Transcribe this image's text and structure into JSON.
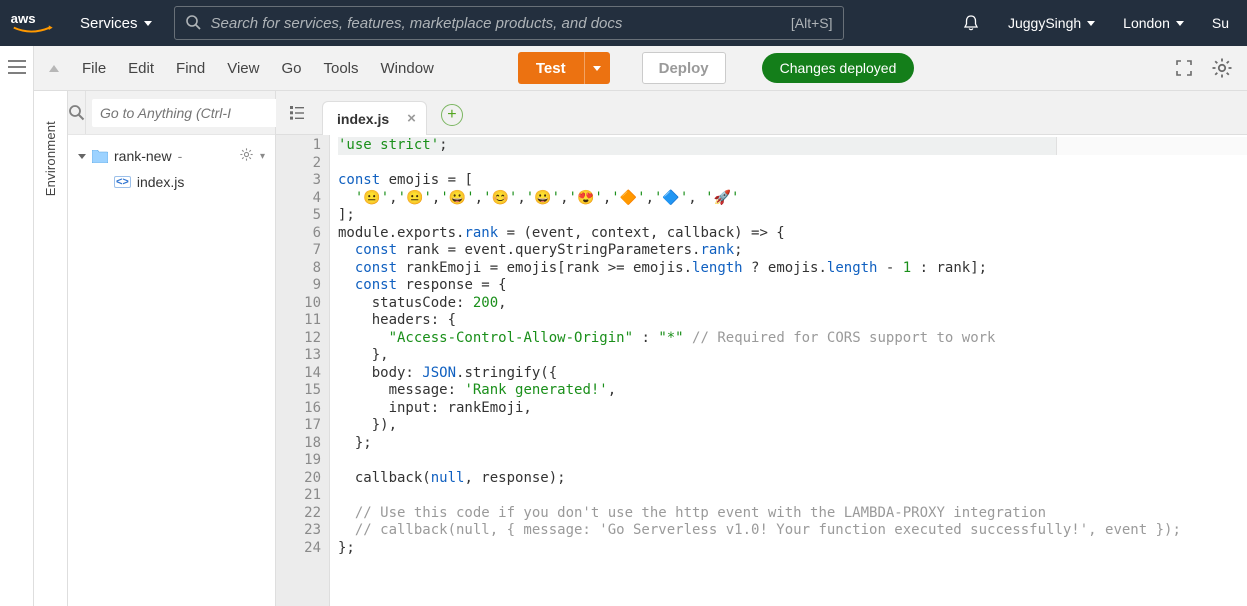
{
  "nav": {
    "services_label": "Services",
    "search_placeholder": "Search for services, features, marketplace products, and docs",
    "search_shortcut": "[Alt+S]",
    "user": "JuggySingh",
    "region": "London",
    "support_truncated": "Su"
  },
  "rail": {
    "label": "Environment"
  },
  "menubar": {
    "items": [
      "File",
      "Edit",
      "Find",
      "View",
      "Go",
      "Tools",
      "Window"
    ],
    "test": "Test",
    "deploy": "Deploy",
    "status": "Changes deployed"
  },
  "sidebar": {
    "goto_placeholder": "Go to Anything (Ctrl-I",
    "folder": "rank-new",
    "folder_suffix": " - ",
    "file": "index.js"
  },
  "tabs": {
    "active": "index.js"
  },
  "code": {
    "lines": [
      [
        [
          "str",
          "'use strict'"
        ],
        [
          "id",
          ";"
        ]
      ],
      [],
      [
        [
          "kw",
          "const"
        ],
        [
          "id",
          " emojis = ["
        ]
      ],
      [
        [
          "id",
          "  "
        ],
        [
          "str",
          "'😐'"
        ],
        [
          "id",
          ","
        ],
        [
          "str",
          "'😐'"
        ],
        [
          "id",
          ","
        ],
        [
          "str",
          "'😀'"
        ],
        [
          "id",
          ","
        ],
        [
          "str",
          "'😊'"
        ],
        [
          "id",
          ","
        ],
        [
          "str",
          "'😀'"
        ],
        [
          "id",
          ","
        ],
        [
          "str",
          "'😍'"
        ],
        [
          "id",
          ","
        ],
        [
          "str",
          "'🔶'"
        ],
        [
          "id",
          ","
        ],
        [
          "str",
          "'🔷'"
        ],
        [
          "id",
          ", "
        ],
        [
          "str",
          "'🚀'"
        ]
      ],
      [
        [
          "id",
          "];"
        ]
      ],
      [
        [
          "id",
          "module.exports."
        ],
        [
          "prop",
          "rank"
        ],
        [
          "id",
          " = (event, context, callback) => {"
        ]
      ],
      [
        [
          "id",
          "  "
        ],
        [
          "kw",
          "const"
        ],
        [
          "id",
          " rank = event.queryStringParameters."
        ],
        [
          "prop",
          "rank"
        ],
        [
          "id",
          ";"
        ]
      ],
      [
        [
          "id",
          "  "
        ],
        [
          "kw",
          "const"
        ],
        [
          "id",
          " rankEmoji = emojis[rank >= emojis."
        ],
        [
          "prop",
          "length"
        ],
        [
          "id",
          " ? emojis."
        ],
        [
          "prop",
          "length"
        ],
        [
          "id",
          " - "
        ],
        [
          "num",
          "1"
        ],
        [
          "id",
          " : rank];"
        ]
      ],
      [
        [
          "id",
          "  "
        ],
        [
          "kw",
          "const"
        ],
        [
          "id",
          " response = {"
        ]
      ],
      [
        [
          "id",
          "    statusCode: "
        ],
        [
          "num",
          "200"
        ],
        [
          "id",
          ","
        ]
      ],
      [
        [
          "id",
          "    headers: {"
        ]
      ],
      [
        [
          "id",
          "      "
        ],
        [
          "str",
          "\"Access-Control-Allow-Origin\""
        ],
        [
          "id",
          " : "
        ],
        [
          "str",
          "\"*\""
        ],
        [
          "id",
          " "
        ],
        [
          "com",
          "// Required for CORS support to work"
        ]
      ],
      [
        [
          "id",
          "    },"
        ]
      ],
      [
        [
          "id",
          "    body: "
        ],
        [
          "prop",
          "JSON"
        ],
        [
          "id",
          ".stringify({"
        ]
      ],
      [
        [
          "id",
          "      message: "
        ],
        [
          "str",
          "'Rank generated!'"
        ],
        [
          "id",
          ","
        ]
      ],
      [
        [
          "id",
          "      input: rankEmoji,"
        ]
      ],
      [
        [
          "id",
          "    }),"
        ]
      ],
      [
        [
          "id",
          "  };"
        ]
      ],
      [],
      [
        [
          "id",
          "  callback("
        ],
        [
          "kw",
          "null"
        ],
        [
          "id",
          ", response);"
        ]
      ],
      [],
      [
        [
          "id",
          "  "
        ],
        [
          "com",
          "// Use this code if you don't use the http event with the LAMBDA-PROXY integration"
        ]
      ],
      [
        [
          "id",
          "  "
        ],
        [
          "com",
          "// callback(null, { message: 'Go Serverless v1.0! Your function executed successfully!', event });"
        ]
      ],
      [
        [
          "id",
          "};"
        ]
      ]
    ]
  }
}
